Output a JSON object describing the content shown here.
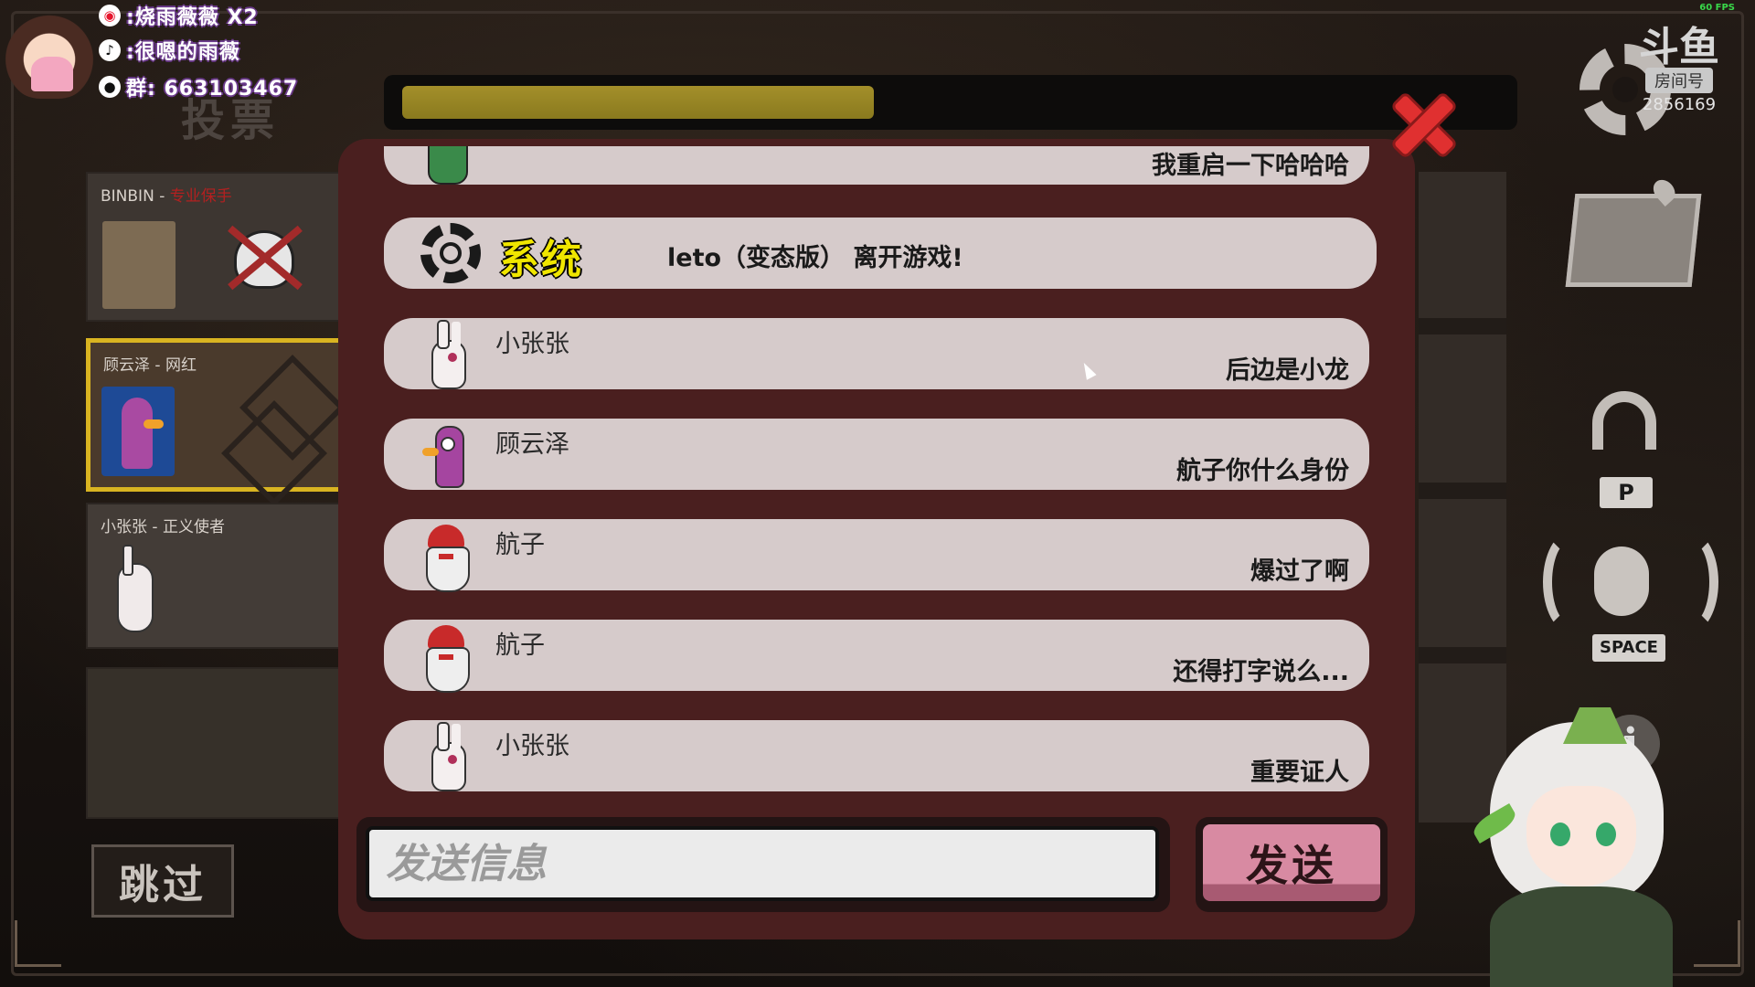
{
  "overlay": {
    "weibo": ":烧雨薇薇 X2",
    "douyin": ":很嗯的雨薇",
    "qq_group": "群: 663103467"
  },
  "fps": "60 FPS",
  "vote": {
    "title": "投票"
  },
  "players": [
    {
      "name": "BINBIN",
      "role": "专业保手",
      "status": "dead"
    },
    {
      "name": "顾云泽",
      "role": "网红",
      "selected": true
    },
    {
      "name": "小张张",
      "role": "正义使者"
    }
  ],
  "skip_label": "跳过",
  "room": {
    "logo": "斗鱼",
    "label": "房间号",
    "number": "2856169"
  },
  "keys": {
    "push_to_talk": "P",
    "voice": "SPACE",
    "info": "i"
  },
  "timer": {
    "remaining_fraction": 0.43
  },
  "chat": {
    "system_label": "系统",
    "messages": [
      {
        "type": "player",
        "sender": "",
        "character": "croc",
        "text": "我重启一下哈哈哈"
      },
      {
        "type": "system",
        "text": "leto（变态版） 离开游戏!"
      },
      {
        "type": "player",
        "sender": "小张张",
        "character": "rabbit",
        "text": "后边是小龙"
      },
      {
        "type": "player",
        "sender": "顾云泽",
        "character": "goose",
        "text": "航子你什么身份"
      },
      {
        "type": "player",
        "sender": "航子",
        "character": "santa",
        "text": "爆过了啊"
      },
      {
        "type": "player",
        "sender": "航子",
        "character": "santa",
        "text": "还得打字说么..."
      },
      {
        "type": "player",
        "sender": "小张张",
        "character": "rabbit",
        "text": "重要证人"
      }
    ],
    "input_placeholder": "发送信息",
    "send_label": "发送"
  },
  "colors": {
    "panel": "#4a1f1f",
    "bubble": "#d6cbcb",
    "system_label": "#f0e600",
    "timer_fill": "#a38f2a",
    "close": "#e03030",
    "send": "#d88aa2",
    "selected_border": "#d9b421"
  }
}
